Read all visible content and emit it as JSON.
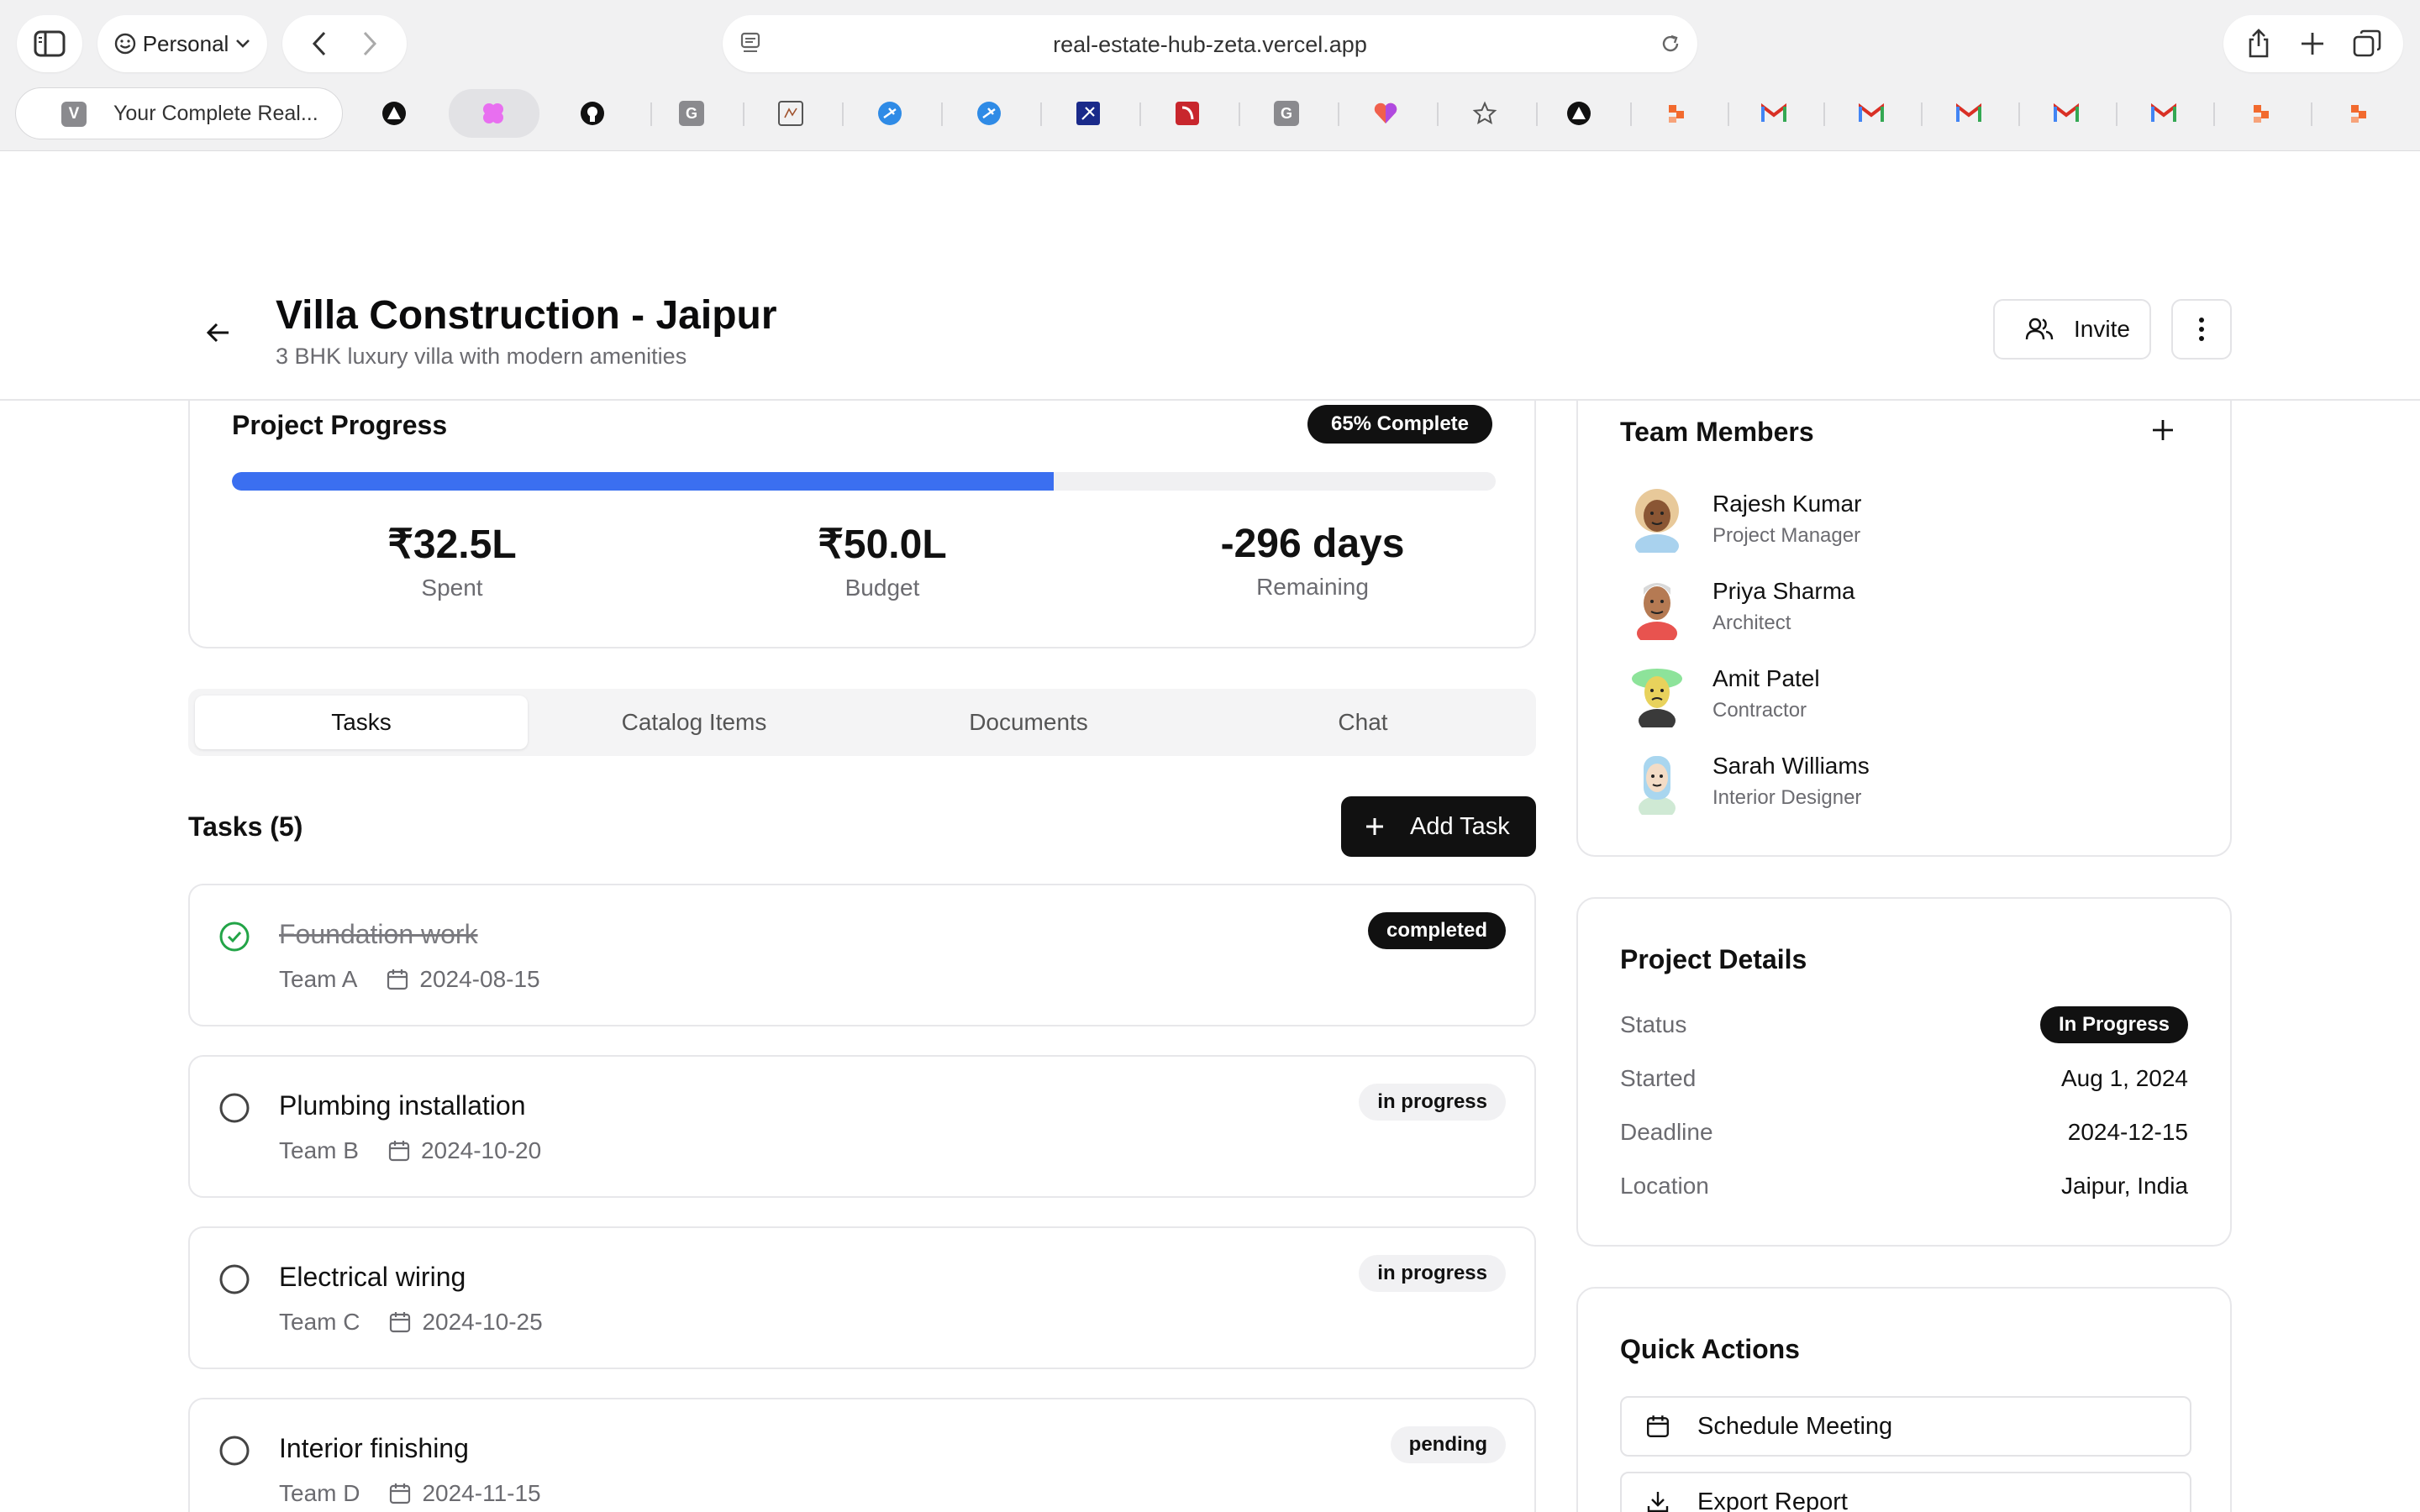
{
  "browser": {
    "profile_label": "Personal",
    "url": "real-estate-hub-zeta.vercel.app",
    "active_tab_title": "Your Complete Real...",
    "active_tab_favicon_letter": "V"
  },
  "header": {
    "title": "Villa Construction - Jaipur",
    "subtitle": "3 BHK luxury villa with modern amenities",
    "invite_label": "Invite"
  },
  "progress": {
    "title": "Project Progress",
    "badge": "65% Complete",
    "percent": 65,
    "accent_color": "#3b6ff0",
    "stats": [
      {
        "value": "₹32.5L",
        "label": "Spent"
      },
      {
        "value": "₹50.0L",
        "label": "Budget"
      },
      {
        "value": "-296 days",
        "label": "Remaining"
      }
    ]
  },
  "tabs": [
    {
      "label": "Tasks"
    },
    {
      "label": "Catalog Items"
    },
    {
      "label": "Documents"
    },
    {
      "label": "Chat"
    }
  ],
  "tasks_section": {
    "heading": "Tasks (5)",
    "add_label": "Add Task",
    "items": [
      {
        "name": "Foundation work",
        "team": "Team A",
        "date": "2024-08-15",
        "status": "completed",
        "done": true
      },
      {
        "name": "Plumbing installation",
        "team": "Team B",
        "date": "2024-10-20",
        "status": "in progress",
        "done": false
      },
      {
        "name": "Electrical wiring",
        "team": "Team C",
        "date": "2024-10-25",
        "status": "in progress",
        "done": false
      },
      {
        "name": "Interior finishing",
        "team": "Team D",
        "date": "2024-11-15",
        "status": "pending",
        "done": false
      }
    ]
  },
  "team": {
    "title": "Team Members",
    "members": [
      {
        "name": "Rajesh Kumar",
        "role": "Project Manager"
      },
      {
        "name": "Priya Sharma",
        "role": "Architect"
      },
      {
        "name": "Amit Patel",
        "role": "Contractor"
      },
      {
        "name": "Sarah Williams",
        "role": "Interior Designer"
      }
    ]
  },
  "details": {
    "title": "Project Details",
    "status_label": "Status",
    "status_value": "In Progress",
    "started_label": "Started",
    "started_value": "Aug 1, 2024",
    "deadline_label": "Deadline",
    "deadline_value": "2024-12-15",
    "location_label": "Location",
    "location_value": "Jaipur, India"
  },
  "quick_actions": {
    "title": "Quick Actions",
    "schedule_label": "Schedule Meeting",
    "export_label": "Export Report"
  }
}
